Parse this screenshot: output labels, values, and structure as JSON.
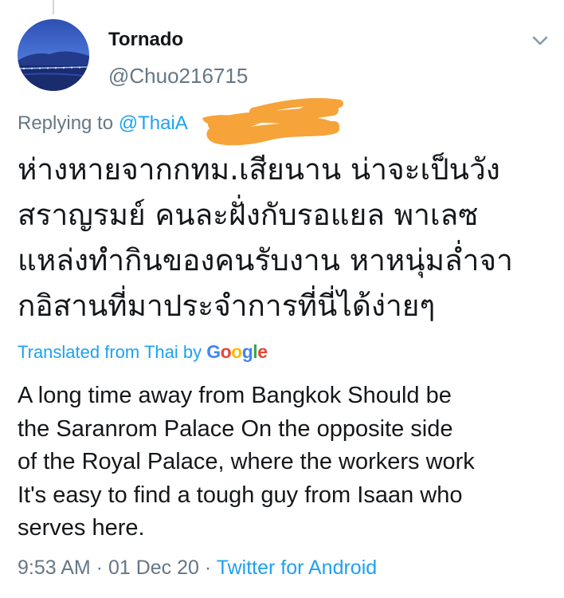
{
  "tweet": {
    "display_name": "Tornado",
    "handle": "@Chuo216715",
    "replying_prefix": "Replying to ",
    "replying_mention": "@ThaiA",
    "thai_lines": [
      "ห่างหายจากกทม.เสียนาน น่าจะเป็นวัง",
      "สราญรมย์  คนละฝั่งกับรอแยล พาเลซ",
      "แหล่งทำกินของคนรับงาน หาหนุ่มล่ำจา",
      "กอิสานที่มาประจำการที่นี่ได้ง่ายๆ"
    ],
    "translated_label": "Translated from Thai by ",
    "google_letters": [
      "G",
      "o",
      "o",
      "g",
      "l",
      "e"
    ],
    "translation_lines": [
      "A long time away from Bangkok Should be",
      "the Saranrom Palace On the opposite side",
      "of the Royal Palace, where the workers work",
      "It's easy to find a tough guy from Isaan who",
      "serves here."
    ],
    "time": "9:53 AM",
    "separator": " · ",
    "date": "01 Dec 20",
    "source": "Twitter for Android"
  },
  "icons": {
    "chevron": "chevron-down-icon",
    "avatar": "avatar-night-bridge"
  },
  "colors": {
    "link": "#1da1f2",
    "muted": "#657786",
    "redaction": "#f6a33a"
  }
}
